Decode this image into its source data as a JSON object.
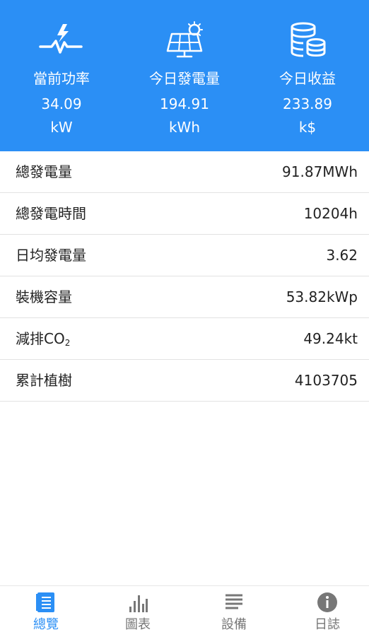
{
  "header": {
    "background_color": "#2b8ff5",
    "stats": [
      {
        "icon": "power-pulse-icon",
        "label": "當前功率",
        "value": "34.09",
        "unit": "kW"
      },
      {
        "icon": "solar-panel-icon",
        "label": "今日發電量",
        "value": "194.91",
        "unit": "kWh"
      },
      {
        "icon": "coins-stack-icon",
        "label": "今日收益",
        "value": "233.89",
        "unit": "k$"
      }
    ]
  },
  "summary": {
    "rows": [
      {
        "label": "總發電量",
        "value": "91.87MWh"
      },
      {
        "label": "總發電時間",
        "value": "10204h"
      },
      {
        "label": "日均發電量",
        "value": "3.62"
      },
      {
        "label": "裝機容量",
        "value": "53.82kWp"
      },
      {
        "label_prefix": "減排CO",
        "label_sub": "2",
        "value": "49.24kt"
      },
      {
        "label": "累計植樹",
        "value": "4103705"
      }
    ]
  },
  "tabbar": {
    "active_color": "#2b8ff5",
    "inactive_color": "#777777",
    "tabs": [
      {
        "icon": "overview-icon",
        "label": "總覽",
        "active": true
      },
      {
        "icon": "bar-chart-icon",
        "label": "圖表",
        "active": false
      },
      {
        "icon": "list-lines-icon",
        "label": "設備",
        "active": false
      },
      {
        "icon": "info-circle-icon",
        "label": "日誌",
        "active": false
      }
    ]
  }
}
